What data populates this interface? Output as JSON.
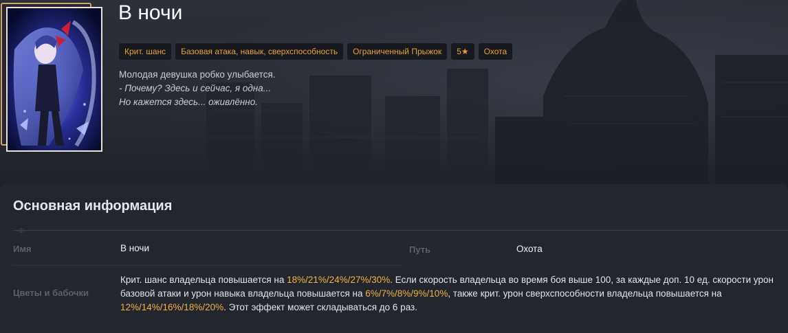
{
  "lightcone": {
    "title": "В ночи",
    "tags": [
      "Крит. шанс",
      "Базовая атака, навык, сверхспособность",
      "Ограниченный Прыжок",
      "5★",
      "Охота"
    ],
    "description": [
      "Молодая девушка робко улыбается.",
      "- Почему? Здесь и сейчас, я одна...",
      "Но кажется здесь... оживлённо."
    ]
  },
  "info": {
    "section_title": "Основная информация",
    "name_label": "Имя",
    "name_value": "В ночи",
    "path_label": "Путь",
    "path_value": "Охота",
    "effect_label": "Цветы и бабочки",
    "effect": {
      "p1": "Крит. шанс владельца повышается на ",
      "v1": "18%/21%/24%/27%/30%",
      "p2": ". Если скорость владельца во время боя выше 100, за каждые доп. 10 ед. скорости урон базовой атаки и урон навыка владельца повышается на ",
      "v2": "6%/7%/8%/9%/10%",
      "p3": ", также крит. урон сверхспособности владельца повышается на ",
      "v3": "12%/14%/16%/18%/20%",
      "p4": ". Этот эффект может складываться до 6 раз."
    }
  },
  "colors": {
    "accent": "#e8a238",
    "highlight": "#f0b24a",
    "panel_bg": "#23262d",
    "tag_bg": "#17191e"
  }
}
